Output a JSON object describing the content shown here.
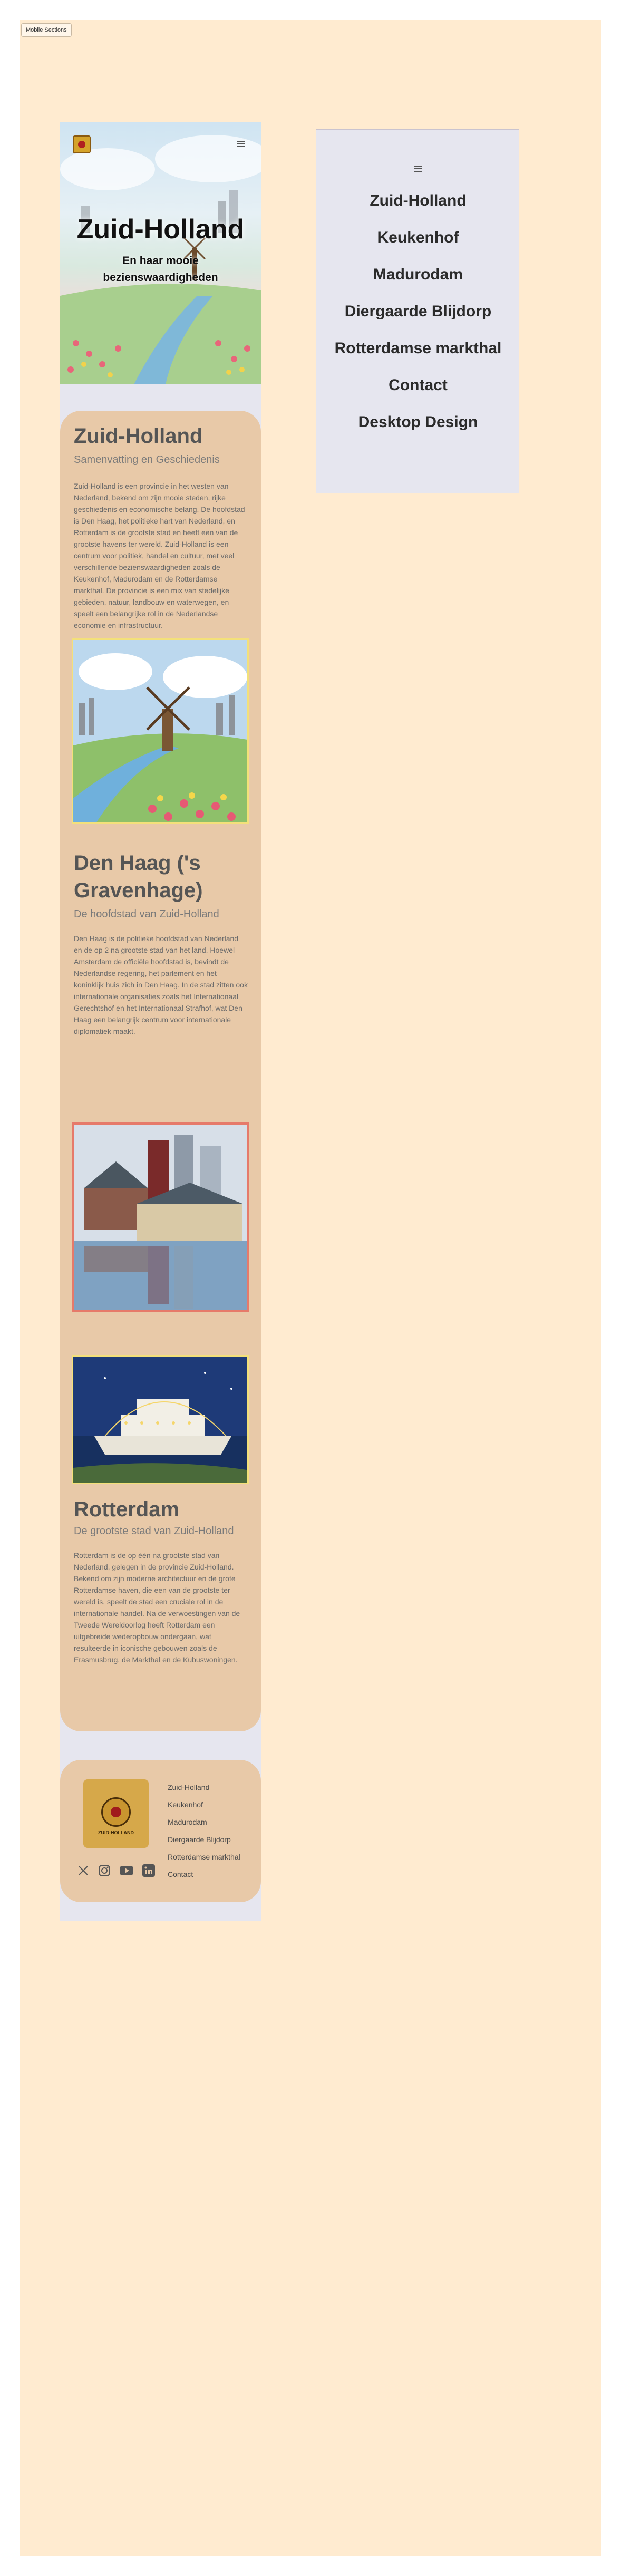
{
  "page": {
    "mode_button": "Mobile Sections"
  },
  "hero": {
    "title": "Zuid-Holland",
    "subtitle": "En haar mooie bezienswaardigheden"
  },
  "sections": [
    {
      "title": "Zuid-Holland",
      "subtitle": "Samenvatting en Geschiedenis",
      "text": "Zuid-Holland is een provincie in het westen van Nederland, bekend om zijn mooie steden, rijke geschiedenis en economische belang. De hoofdstad is Den Haag, het politieke hart van Nederland, en Rotterdam is de grootste stad en heeft een van de grootste havens ter wereld. Zuid-Holland is een centrum voor politiek, handel en cultuur, met veel verschillende bezienswaardigheden zoals de Keukenhof, Madurodam en de Rotterdamse markthal. De provincie is een mix van stedelijke gebieden, natuur, landbouw en waterwegen, en speelt een belangrijke rol in de Nederlandse economie en infrastructuur."
    },
    {
      "title": "Den Haag ('s Gravenhage)",
      "subtitle": "De hoofdstad van Zuid-Holland",
      "text": "Den Haag is de politieke hoofdstad van Nederland en de op 2 na grootste stad van het land. Hoewel Amsterdam de officiële hoofdstad is, bevindt de Nederlandse regering, het parlement en het koninklijk huis zich in Den Haag. In de stad zitten ook internationale organisaties zoals het Internationaal Gerechtshof en het Internationaal Strafhof, wat Den Haag een belangrijk centrum voor internationale diplomatiek maakt."
    },
    {
      "title": "Rotterdam",
      "subtitle": "De grootste stad van Zuid-Holland",
      "text": "Rotterdam is de op één na grootste stad van Nederland, gelegen in de provincie Zuid-Holland. Bekend om zijn moderne architectuur en de grote Rotterdamse haven, die een van de grootste ter wereld is, speelt de stad een cruciale rol in de internationale handel. Na de verwoestingen van de Tweede Wereldoorlog heeft Rotterdam een uitgebreide wederopbouw ondergaan, wat resulteerde in iconische gebouwen zoals de Erasmusbrug, de Markthal en de Kubuswoningen."
    }
  ],
  "footer": {
    "logo_text": "ZUID-HOLLAND",
    "links": [
      "Zuid-Holland",
      "Keukenhof",
      "Madurodam",
      "Diergaarde Blijdorp",
      "Rotterdamse markthal",
      "Contact"
    ],
    "social_icons": [
      "x-icon",
      "instagram-icon",
      "youtube-icon",
      "linkedin-icon"
    ]
  },
  "desktop_menu": {
    "items": [
      "Zuid-Holland",
      "Keukenhof",
      "Madurodam",
      "Diergaarde Blijdorp",
      "Rotterdamse markthal",
      "Contact",
      "Desktop Design"
    ]
  },
  "colors": {
    "page_bg": "#ffebd0",
    "card": "#e8c9a8",
    "panel": "#e6e6ef"
  }
}
